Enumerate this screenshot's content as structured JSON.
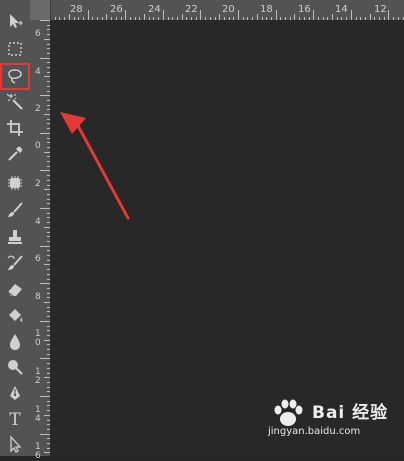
{
  "top_ruler": {
    "labels": [
      "28",
      "26",
      "24",
      "22",
      "20",
      "18",
      "16",
      "14",
      "12"
    ]
  },
  "left_ruler": {
    "labels": [
      "6",
      "4",
      "2",
      "0",
      "2",
      "4",
      "6",
      "8",
      "1\n0",
      "1\n2",
      "1\n4",
      "1\n6"
    ]
  },
  "tools": [
    {
      "name": "move-tool",
      "icon": "move-icon"
    },
    {
      "name": "rectangular-marquee-tool",
      "icon": "marquee-icon"
    },
    {
      "name": "lasso-tool",
      "icon": "lasso-icon",
      "selected": true
    },
    {
      "name": "magic-wand-tool",
      "icon": "magic-wand-icon"
    },
    {
      "name": "crop-tool",
      "icon": "crop-icon"
    },
    {
      "name": "eyedropper-tool",
      "icon": "eyedropper-icon"
    },
    {
      "name": "spot-healing-tool",
      "icon": "healing-icon"
    },
    {
      "name": "brush-tool",
      "icon": "brush-icon"
    },
    {
      "name": "clone-stamp-tool",
      "icon": "stamp-icon"
    },
    {
      "name": "history-brush-tool",
      "icon": "history-brush-icon"
    },
    {
      "name": "eraser-tool",
      "icon": "eraser-icon"
    },
    {
      "name": "paint-bucket-tool",
      "icon": "bucket-icon"
    },
    {
      "name": "blur-tool",
      "icon": "drop-icon"
    },
    {
      "name": "dodge-tool",
      "icon": "dodge-icon"
    },
    {
      "name": "pen-tool",
      "icon": "pen-icon"
    },
    {
      "name": "type-tool",
      "icon": "type-icon",
      "glyph": "T"
    },
    {
      "name": "path-selection-tool",
      "icon": "path-select-icon"
    }
  ],
  "annotation": {
    "color": "#e53935"
  },
  "watermark": {
    "brand": "Bai 经验",
    "url": "jingyan.baidu.com"
  }
}
